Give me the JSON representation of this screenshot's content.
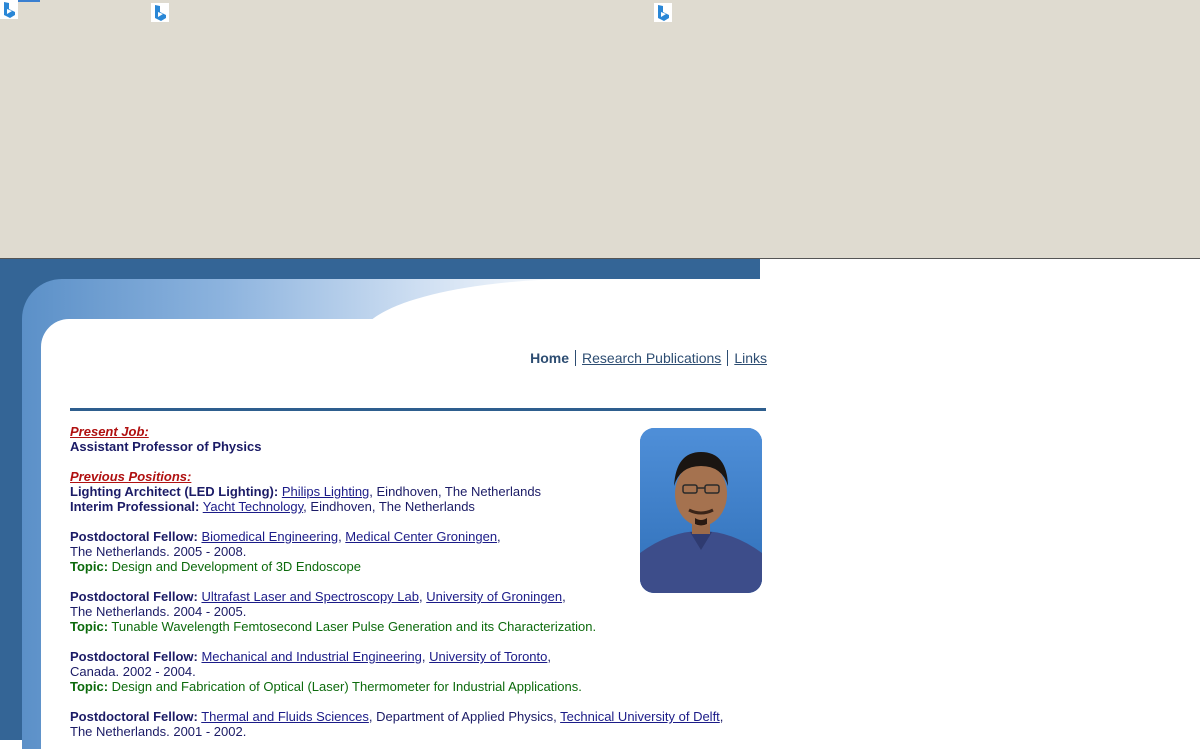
{
  "nav": {
    "home": "Home",
    "research": "Research Publications",
    "links": "Links"
  },
  "present": {
    "heading": "Present Job:",
    "title": "Assistant Professor of Physics"
  },
  "previous": {
    "heading": "Previous Positions:",
    "lighting_role": "Lighting Architect (LED Lighting):",
    "lighting_company": "Philips Lighting",
    "lighting_loc": ", Eindhoven, The Netherlands",
    "interim_role": "Interim Professional:",
    "interim_company": "Yacht Technology",
    "interim_loc": ", Eindhoven, The Netherlands"
  },
  "postdocs": [
    {
      "role": "Postdoctoral Fellow:",
      "link1": "Biomedical Engineering",
      "sep": ", ",
      "link2": "Medical Center Groningen",
      "end1": ",",
      "line2": "The Netherlands. 2005 - 2008.",
      "topic_label": "Topic:",
      "topic": "Design and Development of 3D Endoscope"
    },
    {
      "role": "Postdoctoral Fellow:",
      "link1": "Ultrafast Laser and Spectroscopy Lab",
      "sep": ", ",
      "link2": "University of Groningen",
      "end1": ",",
      "line2": "The Netherlands. 2004 - 2005.",
      "topic_label": "Topic:",
      "topic": "Tunable Wavelength Femtosecond Laser Pulse Generation and its Characterization."
    },
    {
      "role": "Postdoctoral Fellow:",
      "link1": "Mechanical and Industrial Engineering",
      "sep": ", ",
      "link2": "University of Toronto",
      "end1": ",",
      "line2": "Canada. 2002 - 2004.",
      "topic_label": "Topic:",
      "topic": "Design and Fabrication of Optical (Laser) Thermometer for Industrial Applications."
    },
    {
      "role": "Postdoctoral Fellow:",
      "link1": "Thermal and Fluids Sciences",
      "sep": ", Department of Applied Physics, ",
      "link2": "Technical University of Delft",
      "end1": ",",
      "line2": "The Netherlands. 2001 - 2002."
    }
  ],
  "colors": {
    "frame": "#346596",
    "top_bg": "#dfdbd0",
    "heading": "#b01010",
    "topic": "#0c6a0c"
  },
  "icons": [
    "bing-icon",
    "bing-icon",
    "bing-icon"
  ]
}
